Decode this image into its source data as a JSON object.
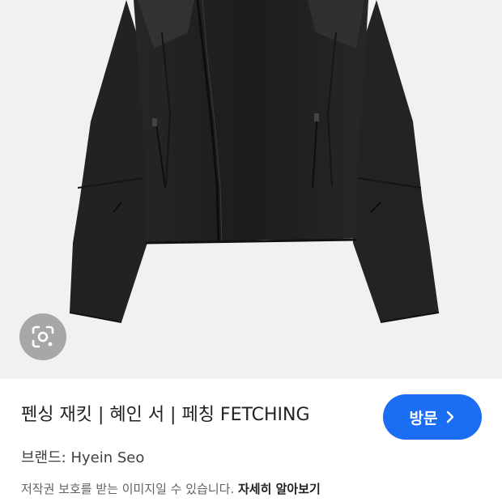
{
  "product": {
    "title": "펜싱 재킷 | 혜인 서 | 페칭 FETCHING",
    "brand_label": "브랜드:",
    "brand_value": "Hyein Seo",
    "visit_button": "방문",
    "copyright_text": "저작권 보호를 받는 이미지일 수 있습니다.",
    "learn_more": "자세히 알아보기"
  },
  "icons": {
    "lens": "google-lens-icon",
    "visit_chevron": "chevron-right-icon"
  },
  "colors": {
    "visit_button_bg": "#1b6ef3",
    "photo_bg": "#f1f1f1",
    "lens_button_bg": "#a7a7a7"
  }
}
